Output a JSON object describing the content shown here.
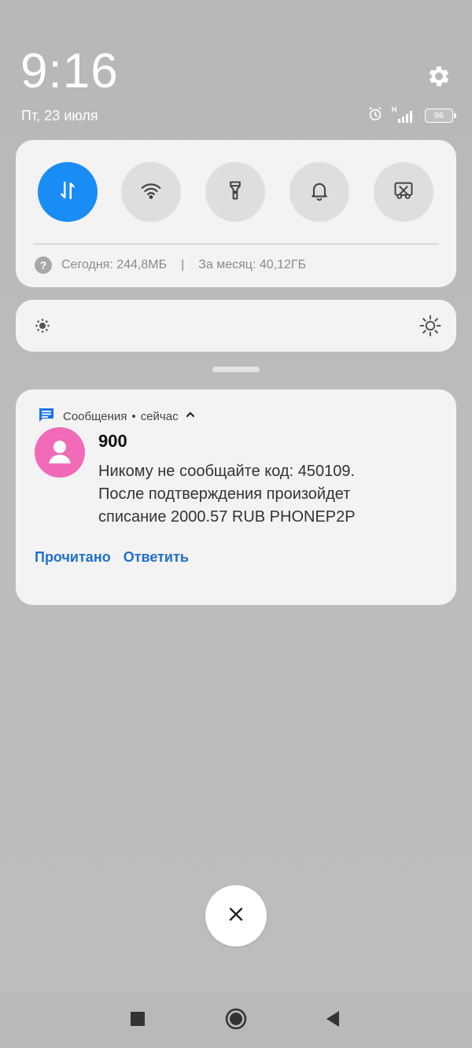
{
  "status": {
    "time": "9:16",
    "date": "Пт, 23 июля",
    "network_label": "H",
    "battery": "96"
  },
  "quick_settings": {
    "tiles": [
      {
        "name": "mobile-data",
        "icon": "data-transfer-icon",
        "active": true
      },
      {
        "name": "wifi",
        "icon": "wifi-icon",
        "active": false
      },
      {
        "name": "flashlight",
        "icon": "flashlight-icon",
        "active": false
      },
      {
        "name": "sound",
        "icon": "bell-icon",
        "active": false
      },
      {
        "name": "screenshot",
        "icon": "scissors-icon",
        "active": false
      }
    ],
    "usage_today": "Сегодня: 244,8МБ",
    "usage_separator": "|",
    "usage_month": "За месяц: 40,12ГБ",
    "help_glyph": "?"
  },
  "brightness": {
    "low_icon": "brightness-low-icon",
    "high_icon": "brightness-high-icon"
  },
  "notification": {
    "app_name": "Сообщения",
    "dot": "•",
    "time": "сейчас",
    "sender": "900",
    "message_lines": [
      "Никому не сообщайте код: 450109.",
      "После подтверждения произойдет",
      "списание 2000.57 RUB PHONEP2P"
    ],
    "actions": [
      "Прочитано",
      "Ответить"
    ]
  },
  "colors": {
    "accent": "#1a8cf6",
    "avatar": "#f06ab8",
    "action_text": "#1f6fd0"
  }
}
